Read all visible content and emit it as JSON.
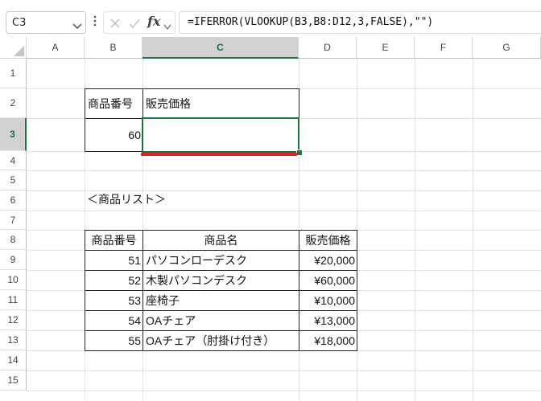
{
  "formula_bar": {
    "name_box": "C3",
    "cancel_icon": "close-icon",
    "enter_icon": "check-icon",
    "fx_label": "fx",
    "formula": "=IFERROR(VLOOKUP(B3,B8:D12,3,FALSE),\"\")"
  },
  "columns": [
    "A",
    "B",
    "C",
    "D",
    "E",
    "F",
    "G"
  ],
  "rows": [
    "1",
    "2",
    "3",
    "4",
    "5",
    "6",
    "7",
    "8",
    "9",
    "10",
    "11",
    "12",
    "13",
    "14",
    "15"
  ],
  "selected_cell": "C3",
  "lookup": {
    "header_code": "商品番号",
    "header_price": "販売価格",
    "code_value": "60",
    "price_value": ""
  },
  "list_title": "＜商品リスト＞",
  "table": {
    "headers": [
      "商品番号",
      "商品名",
      "販売価格"
    ],
    "rows": [
      {
        "code": "51",
        "name": "パソコンローデスク",
        "price": "¥20,000"
      },
      {
        "code": "52",
        "name": "木製パソコンデスク",
        "price": "¥60,000"
      },
      {
        "code": "53",
        "name": "座椅子",
        "price": "¥10,000"
      },
      {
        "code": "54",
        "name": "OAチェア",
        "price": "¥13,000"
      },
      {
        "code": "55",
        "name": "OAチェア（肘掛け付き）",
        "price": "¥18,000"
      }
    ]
  },
  "colors": {
    "selection": "#217346",
    "underline_annotation": "#d9232a"
  }
}
